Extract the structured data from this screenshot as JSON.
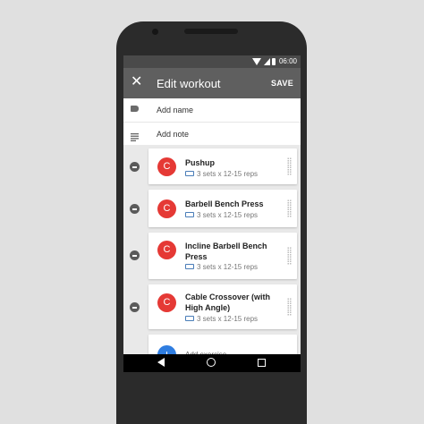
{
  "status": {
    "time": "06:00"
  },
  "appbar": {
    "title": "Edit workout",
    "save_label": "SAVE"
  },
  "fields": {
    "name_placeholder": "Add name",
    "note_placeholder": "Add note"
  },
  "exercises": [
    {
      "avatar": "C",
      "name": "Pushup",
      "meta": "3 sets x 12-15 reps"
    },
    {
      "avatar": "C",
      "name": "Barbell Bench Press",
      "meta": "3 sets x 12-15 reps"
    },
    {
      "avatar": "C",
      "name": "Incline Barbell Bench Press",
      "meta": "3 sets x 12-15 reps"
    },
    {
      "avatar": "C",
      "name": "Cable Crossover (with High Angle)",
      "meta": "3 sets x 12-15 reps"
    }
  ],
  "add": {
    "icon": "+",
    "label": "Add exercise"
  },
  "colors": {
    "accent_red": "#e53935",
    "accent_blue": "#2f7de0",
    "appbar": "#5f5f5f"
  },
  "icons": [
    "close-icon",
    "tag-icon",
    "notes-icon",
    "remove-icon",
    "dumbbell-icon",
    "drag-handle-icon",
    "add-icon",
    "back-icon",
    "home-icon",
    "recents-icon"
  ]
}
